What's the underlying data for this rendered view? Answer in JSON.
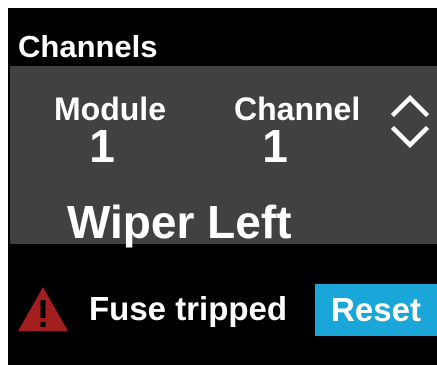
{
  "screen": {
    "title": "Channels"
  },
  "selector": {
    "module_label": "Module",
    "module_value": "1",
    "channel_label": "Channel",
    "channel_value": "1",
    "channel_name": "Wiper Left",
    "up_icon": "chevron-up-icon",
    "down_icon": "chevron-down-icon"
  },
  "status": {
    "icon": "warning-icon",
    "text": "Fuse tripped",
    "icon_color": "#a31f1f"
  },
  "actions": {
    "reset_label": "Reset",
    "reset_color": "#1aa6d9"
  }
}
